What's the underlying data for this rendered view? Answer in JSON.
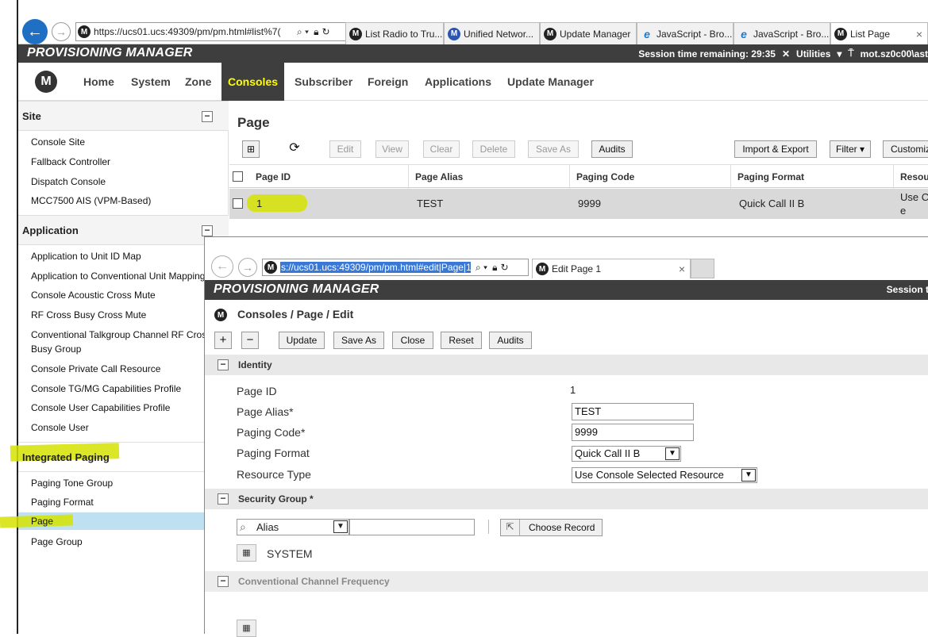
{
  "browser1": {
    "address": "https://ucs01.ucs:49309/pm/pm.html#list%7(",
    "tabs": [
      {
        "label": "List Radio to Tru...",
        "icon": "motorola-icon"
      },
      {
        "label": "Unified Networ...",
        "icon": "motorola-blue-icon"
      },
      {
        "label": "Update Manager",
        "icon": "motorola-icon"
      },
      {
        "label": "JavaScript - Bro...",
        "icon": "ie-icon"
      },
      {
        "label": "JavaScript - Bro...",
        "icon": "ie-icon"
      },
      {
        "label": "List Page",
        "icon": "motorola-icon"
      }
    ],
    "close": "×"
  },
  "app": {
    "title": "PROVISIONING MANAGER",
    "session": "Session time remaining: 29:35",
    "utilities": "Utilities",
    "user": "mot.sz0c00\\ast"
  },
  "nav": {
    "items": [
      "Home",
      "System",
      "Zone",
      "Consoles",
      "Subscriber",
      "Foreign",
      "Applications",
      "Update Manager"
    ],
    "active": "Consoles"
  },
  "sidebar": {
    "sections": [
      {
        "title": "Site",
        "items": [
          "Console Site",
          "Fallback Controller",
          "Dispatch Console",
          "MCC7500 AIS (VPM-Based)"
        ]
      },
      {
        "title": "Application",
        "items": [
          "Application to Unit ID Map",
          "Application to Conventional Unit Mapping",
          "Console Acoustic Cross Mute",
          "RF Cross Busy Cross Mute",
          "Conventional Talkgroup Channel RF Cross Busy Group",
          "Console Private Call Resource",
          "Console TG/MG Capabilities Profile",
          "Console User Capabilities Profile",
          "Console User"
        ]
      },
      {
        "title": "Integrated Paging",
        "items": [
          "Paging Tone Group",
          "Paging Format",
          "Page",
          "Page Group"
        ]
      }
    ],
    "collapse_symbol": "−"
  },
  "list": {
    "title": "Page",
    "toolbar": {
      "edit": "Edit",
      "view": "View",
      "clear": "Clear",
      "delete": "Delete",
      "save_as": "Save As",
      "audits": "Audits",
      "import_export": "Import & Export",
      "filter": "Filter ▾",
      "customize": "Customiz"
    },
    "columns": [
      "Page ID",
      "Page Alias",
      "Paging Code",
      "Paging Format",
      "Resou"
    ],
    "rows": [
      {
        "page_id": "1",
        "alias": "TEST",
        "code": "9999",
        "format": "Quick Call II B",
        "resource": "Use C\ne"
      }
    ]
  },
  "edit_window": {
    "address": "s://ucs01.ucs:49309/pm/pm.html#edit|Page|1",
    "tab": "Edit Page 1",
    "title": "PROVISIONING MANAGER",
    "session": "Session t",
    "breadcrumb": "Consoles / Page / Edit",
    "toolbar": {
      "add": "+",
      "remove": "−",
      "update": "Update",
      "save_as": "Save As",
      "close": "Close",
      "reset": "Reset",
      "audits": "Audits"
    },
    "identity": {
      "heading": "Identity",
      "page_id_label": "Page ID",
      "page_id": "1",
      "alias_label": "Page Alias*",
      "alias": "TEST",
      "code_label": "Paging Code*",
      "code": "9999",
      "format_label": "Paging Format",
      "format": "Quick Call II B",
      "resource_label": "Resource Type",
      "resource": "Use Console Selected Resource"
    },
    "security": {
      "heading": "Security Group *",
      "search_field": "Alias",
      "choose": "Choose Record",
      "value": "SYSTEM"
    },
    "conventional": {
      "heading": "Conventional Channel Frequency"
    }
  }
}
